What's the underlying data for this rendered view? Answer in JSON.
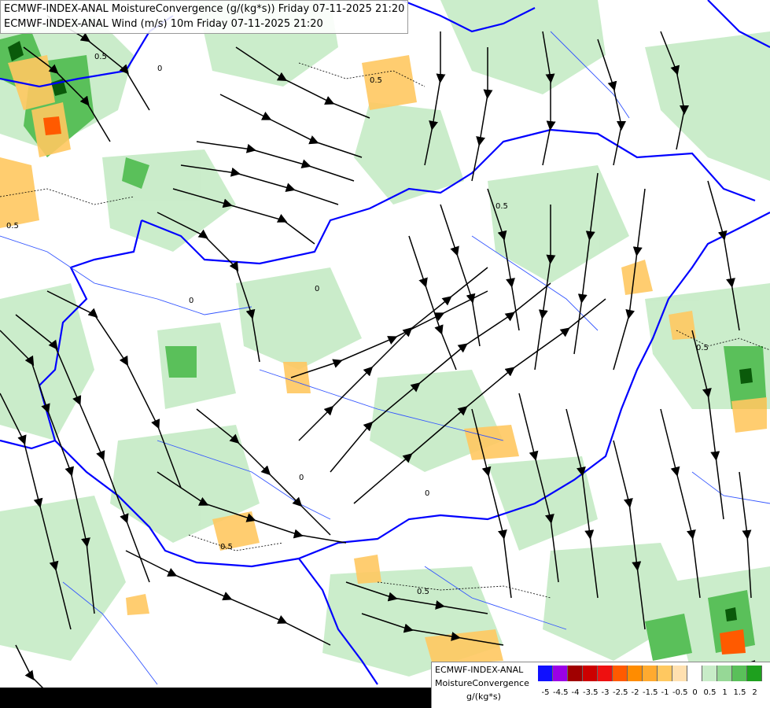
{
  "header": {
    "line1": "ECMWF-INDEX-ANAL MoistureConvergence (g/(kg*s)) Friday 07-11-2025 21:20",
    "line2": "ECMWF-INDEX-ANAL Wind (m/s) 10m Friday 07-11-2025 21:20"
  },
  "map": {
    "contour_labels": [
      "0",
      "0",
      "0",
      "0",
      "0",
      "0.5",
      "0.5",
      "0.5",
      "0.5",
      "0.5",
      "0.5",
      "0.5"
    ],
    "colors": {
      "border": "#0000ff",
      "river": "#3355ff",
      "streamline": "#000000"
    }
  },
  "legend": {
    "title1": "ECMWF-INDEX-ANAL",
    "title2": "MoistureConvergence",
    "unit": "g/(kg*s)",
    "scale": [
      {
        "label": "-5",
        "color": "#1010ff"
      },
      {
        "label": "-4.5",
        "color": "#9a00e6"
      },
      {
        "label": "-4",
        "color": "#a00000"
      },
      {
        "label": "-3.5",
        "color": "#cc0000"
      },
      {
        "label": "-3",
        "color": "#ee1010"
      },
      {
        "label": "-2.5",
        "color": "#ff5a00"
      },
      {
        "label": "-2",
        "color": "#ff8c00"
      },
      {
        "label": "-1.5",
        "color": "#ffaa30"
      },
      {
        "label": "-1",
        "color": "#ffc860"
      },
      {
        "label": "-0.5",
        "color": "#ffe0b0"
      },
      {
        "label": "0",
        "color": "#ffffff"
      },
      {
        "label": "0.5",
        "color": "#c8ecc8"
      },
      {
        "label": "1",
        "color": "#96d896"
      },
      {
        "label": "1.5",
        "color": "#5ac05a"
      },
      {
        "label": "2",
        "color": "#1ea01e"
      }
    ]
  }
}
